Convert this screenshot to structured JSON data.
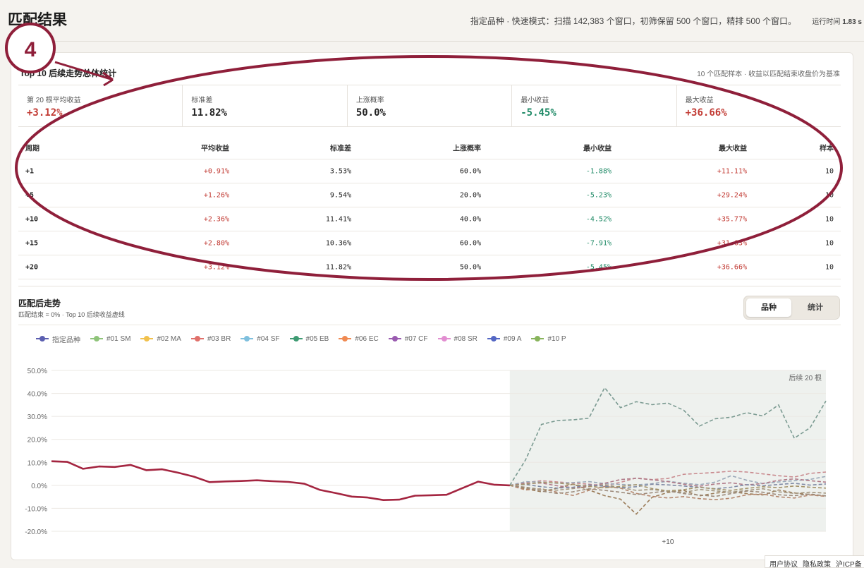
{
  "header": {
    "title": "匹配结果",
    "info": "指定品种 · 快速模式：扫描 142,383 个窗口，初筛保留 500 个窗口，精排 500 个窗口。",
    "runtime_label": "运行时间",
    "runtime_value": "1.83 s"
  },
  "annotation": {
    "number": "4",
    "color": "#8f1f3a"
  },
  "stats": {
    "title": "Top 10 后续走势总体统计",
    "note": "10 个匹配样本 · 收益以匹配结束收盘价为基准",
    "kpis": [
      {
        "label": "第 20 根平均收益",
        "value": "+3.12%",
        "tone": "pos"
      },
      {
        "label": "标准差",
        "value": "11.82%",
        "tone": "neu"
      },
      {
        "label": "上涨概率",
        "value": "50.0%",
        "tone": "neu"
      },
      {
        "label": "最小收益",
        "value": "-5.45%",
        "tone": "neg"
      },
      {
        "label": "最大收益",
        "value": "+36.66%",
        "tone": "pos"
      }
    ],
    "columns": [
      "周期",
      "平均收益",
      "标准差",
      "上涨概率",
      "最小收益",
      "最大收益",
      "样本"
    ],
    "rows": [
      [
        "+1",
        "+0.91%",
        "3.53%",
        "60.0%",
        "-1.88%",
        "+11.11%",
        "10"
      ],
      [
        "+5",
        "+1.26%",
        "9.54%",
        "20.0%",
        "-5.23%",
        "+29.24%",
        "10"
      ],
      [
        "+10",
        "+2.36%",
        "11.41%",
        "40.0%",
        "-4.52%",
        "+35.77%",
        "10"
      ],
      [
        "+15",
        "+2.80%",
        "10.36%",
        "60.0%",
        "-7.91%",
        "+31.63%",
        "10"
      ],
      [
        "+20",
        "+3.12%",
        "11.82%",
        "50.0%",
        "-5.45%",
        "+36.66%",
        "10"
      ]
    ]
  },
  "trend": {
    "title": "匹配后走势",
    "subtitle": "匹配结束 = 0% · Top 10 后续收益虚线",
    "toggle": {
      "active": "品种",
      "other": "统计"
    }
  },
  "chart_data": {
    "type": "line",
    "legend": [
      {
        "name": "指定品种",
        "color": "#5b5fb0"
      },
      {
        "name": "#01 SM",
        "color": "#8fc47a"
      },
      {
        "name": "#02 MA",
        "color": "#f1c14d"
      },
      {
        "name": "#03 BR",
        "color": "#e0706b"
      },
      {
        "name": "#04 SF",
        "color": "#7fc0de"
      },
      {
        "name": "#05 EB",
        "color": "#3f9b73"
      },
      {
        "name": "#06 EC",
        "color": "#f08a52"
      },
      {
        "name": "#07 CF",
        "color": "#9a5bb0"
      },
      {
        "name": "#08 SR",
        "color": "#e28ed1"
      },
      {
        "name": "#09 A",
        "color": "#5467c4"
      },
      {
        "name": "#10 P",
        "color": "#88b45c"
      }
    ],
    "y_ticks": [
      "50.0%",
      "40.0%",
      "30.0%",
      "20.0%",
      "10.0%",
      "0.0%",
      "-10.0%",
      "-20.0%"
    ],
    "ylim": [
      -20,
      50
    ],
    "x_tick_label": "+10",
    "shade_label": "后续 20 根",
    "main_series": {
      "name": "指定品种",
      "color": "#a42540",
      "values": [
        10.5,
        10.2,
        7.2,
        8.2,
        8.0,
        8.9,
        6.6,
        7.0,
        5.5,
        3.8,
        1.4,
        1.7,
        1.9,
        2.2,
        1.8,
        1.5,
        0.7,
        -2.0,
        -3.4,
        -4.9,
        -5.3,
        -6.4,
        -6.2,
        -4.5,
        -4.3,
        -4.1,
        -1.2,
        1.6,
        0.3,
        0.0
      ]
    },
    "future_series": [
      {
        "name": "#01 SM",
        "color": "#7a9a91",
        "values": [
          0,
          11.1,
          26.5,
          28.2,
          28.5,
          29.2,
          42.5,
          33.8,
          36.4,
          35.1,
          35.8,
          32.7,
          25.8,
          29.0,
          29.6,
          31.6,
          30.2,
          35.0,
          20.5,
          25.1,
          36.7
        ]
      },
      {
        "name": "#02 MA",
        "color": "#c98b8f",
        "values": [
          0,
          1.2,
          2.0,
          1.5,
          1.0,
          0.5,
          -0.2,
          1.3,
          3.2,
          2.5,
          3.0,
          4.8,
          5.2,
          5.6,
          6.2,
          5.8,
          5.0,
          4.2,
          3.6,
          5.2,
          5.8
        ]
      },
      {
        "name": "#03 BR",
        "color": "#9c7d5a",
        "values": [
          0,
          -1.5,
          -2.8,
          -1.2,
          0.5,
          -2.0,
          -4.5,
          -6.0,
          -12.5,
          -5.2,
          -3.1,
          -2.2,
          -4.6,
          -3.4,
          -2.8,
          -3.6,
          -4.2,
          -2.0,
          -3.3,
          -4.0,
          -4.6
        ]
      },
      {
        "name": "#04 SF",
        "color": "#9aa8b8",
        "values": [
          0,
          1.6,
          1.4,
          0.9,
          1.2,
          1.6,
          0.8,
          0.4,
          0.2,
          0.7,
          1.8,
          0.9,
          0.3,
          1.4,
          4.2,
          2.2,
          0.8,
          1.5,
          2.0,
          2.6,
          3.9
        ]
      },
      {
        "name": "#05 EB",
        "color": "#b5876e",
        "values": [
          0,
          -2.0,
          -1.5,
          -3.0,
          -4.4,
          -2.2,
          -0.5,
          -1.2,
          -3.5,
          -4.8,
          -5.5,
          -4.9,
          -5.8,
          -6.2,
          -5.6,
          -4.1,
          -3.8,
          -5.0,
          -5.5,
          -4.2,
          -4.8
        ]
      },
      {
        "name": "#06 EC",
        "color": "#a3957e",
        "values": [
          0,
          -0.8,
          -1.8,
          -2.1,
          -1.4,
          -0.6,
          0.3,
          -0.9,
          -2.2,
          -1.8,
          -2.6,
          -3.1,
          -1.8,
          -2.4,
          -3.0,
          -2.2,
          -1.5,
          -2.8,
          -3.5,
          -3.0,
          -3.4
        ]
      },
      {
        "name": "#07 CF",
        "color": "#b07a88",
        "values": [
          0,
          0.8,
          1.0,
          -0.2,
          -1.0,
          -0.4,
          0.9,
          2.5,
          3.1,
          2.4,
          1.6,
          0.5,
          -0.4,
          0.6,
          1.1,
          0.2,
          0.8,
          2.2,
          2.8,
          2.0,
          1.4
        ]
      },
      {
        "name": "#08 SR",
        "color": "#9d8a7a",
        "values": [
          0,
          -1.0,
          -2.5,
          -3.5,
          -2.8,
          -1.5,
          -2.2,
          -3.0,
          -4.0,
          -3.2,
          -2.4,
          -3.6,
          -4.2,
          -4.8,
          -3.6,
          -2.5,
          -3.0,
          -4.1,
          -4.5,
          -3.8,
          -4.6
        ]
      },
      {
        "name": "#09 A",
        "color": "#7f8aa5",
        "values": [
          0,
          0.4,
          -0.6,
          -1.2,
          -0.8,
          0.2,
          -0.4,
          -1.0,
          -0.6,
          0.5,
          0.2,
          -0.3,
          -0.9,
          -1.5,
          -0.8,
          0.3,
          -0.2,
          0.4,
          0.9,
          0.1,
          0.6
        ]
      },
      {
        "name": "#10 P",
        "color": "#a4936a",
        "values": [
          0,
          0.5,
          1.3,
          1.0,
          0.4,
          -0.4,
          -1.1,
          -0.5,
          0.3,
          -1.4,
          -2.4,
          -1.9,
          -0.8,
          -1.6,
          -2.2,
          -1.3,
          -0.6,
          -1.0,
          -0.3,
          -0.8,
          -1.2
        ]
      }
    ]
  },
  "footer": {
    "links": [
      "用户协议",
      "隐私政策",
      "沪ICP备"
    ]
  }
}
